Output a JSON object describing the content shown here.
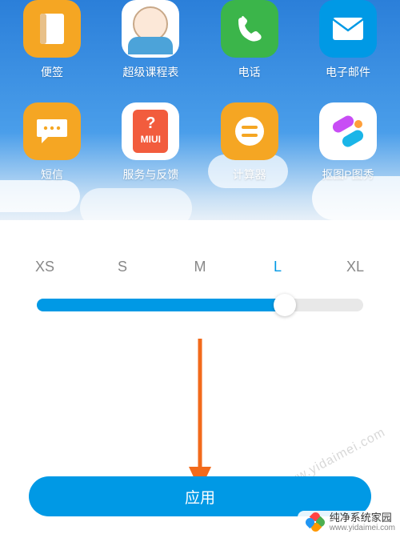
{
  "apps": {
    "row1": [
      {
        "label": "便签",
        "name": "notes"
      },
      {
        "label": "超级课程表",
        "name": "schedule"
      },
      {
        "label": "电话",
        "name": "phone"
      },
      {
        "label": "电子邮件",
        "name": "email"
      }
    ],
    "row2": [
      {
        "label": "短信",
        "name": "sms"
      },
      {
        "label": "服务与反馈",
        "name": "feedback"
      },
      {
        "label": "计算器",
        "name": "calculator"
      },
      {
        "label": "抠图P图秀",
        "name": "koutu"
      }
    ]
  },
  "miui_label": "MIUI",
  "sizes": {
    "options": [
      "XS",
      "S",
      "M",
      "L",
      "XL"
    ],
    "selected_index": 3,
    "selected": "L"
  },
  "apply_button": "应用",
  "watermark": "www.yidaimei.com",
  "brand": {
    "name": "纯净系统家园",
    "url": "www.yidaimei.com"
  },
  "colors": {
    "accent": "#0099e5",
    "orange": "#f5a623",
    "arrow": "#f26a1b"
  }
}
